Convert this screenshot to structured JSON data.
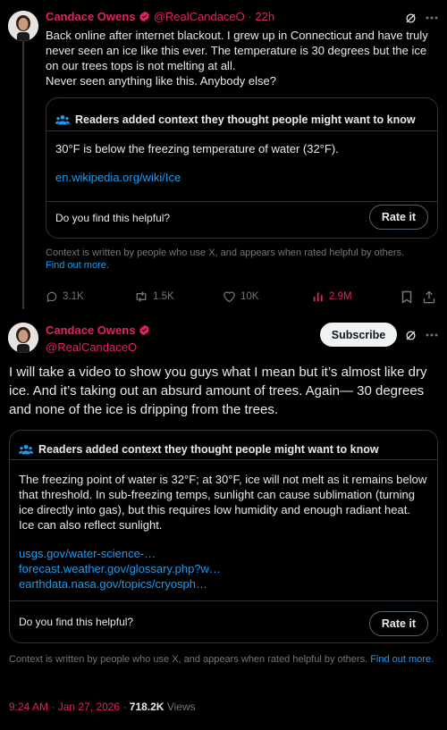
{
  "quoted": {
    "author_name": "Candace Owens",
    "handle": "@RealCandaceO",
    "time": "22h",
    "text": "Back online after internet blackout. I grew up in Connecticut and have truly never seen an ice like this ever. The temperature is 30 degrees but the ice on our trees tops is not melting at all.\nNever seen anything like this. Anybody else?",
    "note": {
      "header": "Readers added context they thought people might want to know",
      "body": "30°F is below the freezing temperature of water (32°F).",
      "link": "en.wikipedia.org/wiki/Ice",
      "question": "Do you find this helpful?",
      "rate_label": "Rate it"
    },
    "context_text": "Context is written by people who use X, and appears when rated helpful by others.",
    "find_out_more": "Find out more.",
    "actions": {
      "replies": "3.1K",
      "reposts": "1.5K",
      "likes": "10K",
      "views": "2.9M"
    }
  },
  "main": {
    "author_name": "Candace Owens",
    "handle": "@RealCandaceO",
    "subscribe_label": "Subscribe",
    "text": "I will take a video to show you guys what I mean but it’s almost like dry ice. And it’s taking out an absurd amount of trees. Again— 30 degrees and none of the ice is dripping from the trees.",
    "note": {
      "header": "Readers added context they thought people might want to know",
      "body": "The freezing point of water is 32°F; at 30°F, ice will not melt as it remains below that threshold. In sub-freezing temps, sunlight can cause sublimation (turning ice directly into gas), but this requires low humidity and enough radiant heat. Ice can also reflect sunlight.",
      "links": [
        "usgs.gov/water-science-…",
        "forecast.weather.gov/glossary.php?w…",
        "earthdata.nasa.gov/topics/cryosph…"
      ],
      "question": "Do you find this helpful?",
      "rate_label": "Rate it"
    },
    "context_text": "Context is written by people who use X, and appears when rated helpful by others.",
    "find_out_more": "Find out more.",
    "timestamp": "9:24 AM · Jan 27, 2026",
    "views_count": "718.2K",
    "views_label": "Views"
  },
  "colors": {
    "accent_red": "#e0245e",
    "link_blue": "#1d9bf0",
    "muted": "#71767b"
  }
}
